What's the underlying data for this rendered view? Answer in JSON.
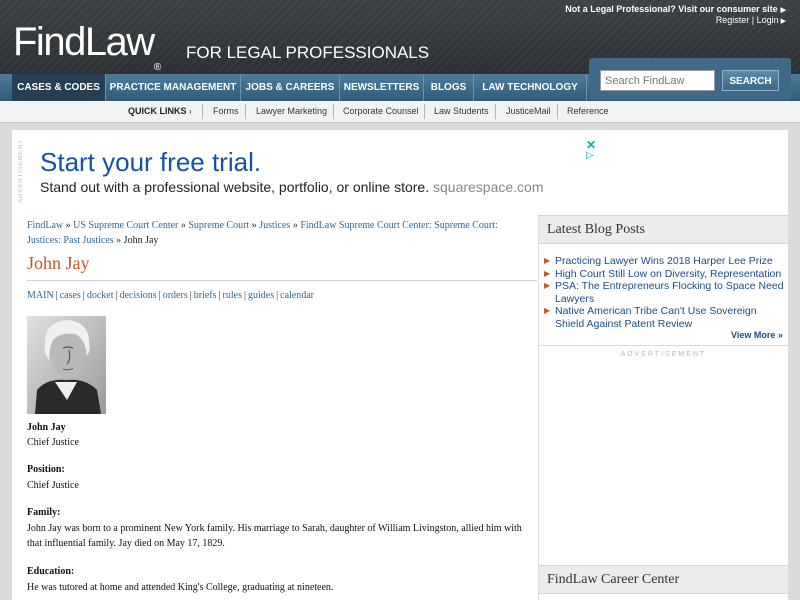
{
  "header": {
    "consumer_link": "Not a Legal Professional? Visit our consumer site",
    "register": "Register",
    "login": "Login",
    "account_sep": "|",
    "logo": "FindLaw",
    "logo_reg": "®",
    "tagline": "FOR LEGAL PROFESSIONALS"
  },
  "nav": {
    "items": [
      "CASES & CODES",
      "PRACTICE MANAGEMENT",
      "JOBS & CAREERS",
      "NEWSLETTERS",
      "BLOGS",
      "LAW TECHNOLOGY"
    ],
    "search_placeholder": "Search FindLaw",
    "search_button": "SEARCH"
  },
  "quick_links": {
    "label": "QUICK LINKS",
    "items": [
      "Forms",
      "Lawyer Marketing",
      "Corporate Counsel",
      "Law Students",
      "JusticeMail",
      "Reference"
    ]
  },
  "ad": {
    "vertical_label": "ADVERTISEMENT",
    "title": "Start your free trial.",
    "subtitle": "Stand out with a professional website, portfolio, or online store.",
    "domain": "squarespace.com",
    "close": "✕",
    "play": "▷"
  },
  "breadcrumb": {
    "items": [
      "FindLaw",
      "US Supreme Court Center",
      "Supreme Court",
      "Justices",
      "FindLaw Supreme Court Center: Supreme Court: Justices: Past Justices"
    ],
    "separator": "»",
    "current": "John Jay"
  },
  "page_title": "John Jay",
  "tabs": [
    "MAIN",
    "cases",
    "docket",
    "decisions",
    "orders",
    "briefs",
    "rules",
    "guides",
    "calendar"
  ],
  "tab_separator": "|",
  "profile": {
    "name": "John Jay",
    "role": "Chief Justice",
    "position_label": "Position:",
    "position_value": "Chief Justice",
    "family_label": "Family:",
    "family_text": "John Jay was born to a prominent New York family. His marriage to Sarah, daughter of William Livingston, allied him with that influential family. Jay died on May 17, 1829.",
    "education_label": "Education:",
    "education_text": "He was tutored at home and attended King's College, graduating at nineteen."
  },
  "sidebar": {
    "blog_title": "Latest Blog Posts",
    "posts": [
      "Practicing Lawyer Wins 2018 Harper Lee Prize",
      "High Court Still Low on Diversity, Representation",
      "PSA: The Entrepreneurs Flocking to Space Need Lawyers",
      "Native American Tribe Can't Use Sovereign Shield Against Patent Review"
    ],
    "view_more": "View More »",
    "advertisement": "ADVERTISEMENT",
    "career_title": "FindLaw Career Center"
  },
  "colors": {
    "nav_active": "#263f52",
    "link": "#2d6897",
    "title_accent": "#c5552d",
    "ad_blue": "#1452a8"
  }
}
